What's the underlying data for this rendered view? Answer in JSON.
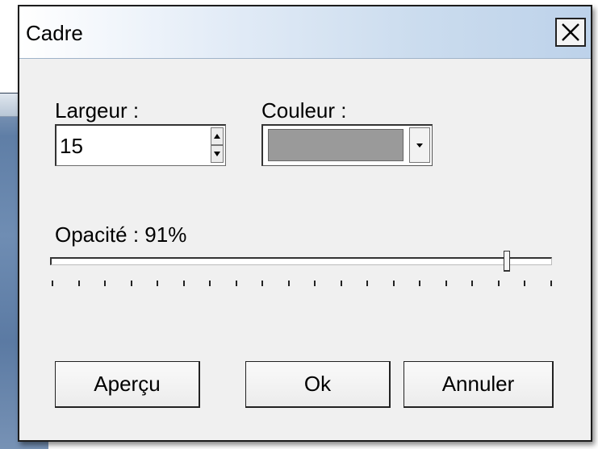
{
  "dialog": {
    "title": "Cadre",
    "close_label": "✕"
  },
  "width_field": {
    "label": "Largeur :",
    "value": "15"
  },
  "color_field": {
    "label": "Couleur :",
    "selected_color": "#9a9a9a"
  },
  "opacity": {
    "label": "Opacité : 91%",
    "value_percent": 91
  },
  "buttons": {
    "preview": "Aperçu",
    "ok": "Ok",
    "cancel": "Annuler"
  }
}
